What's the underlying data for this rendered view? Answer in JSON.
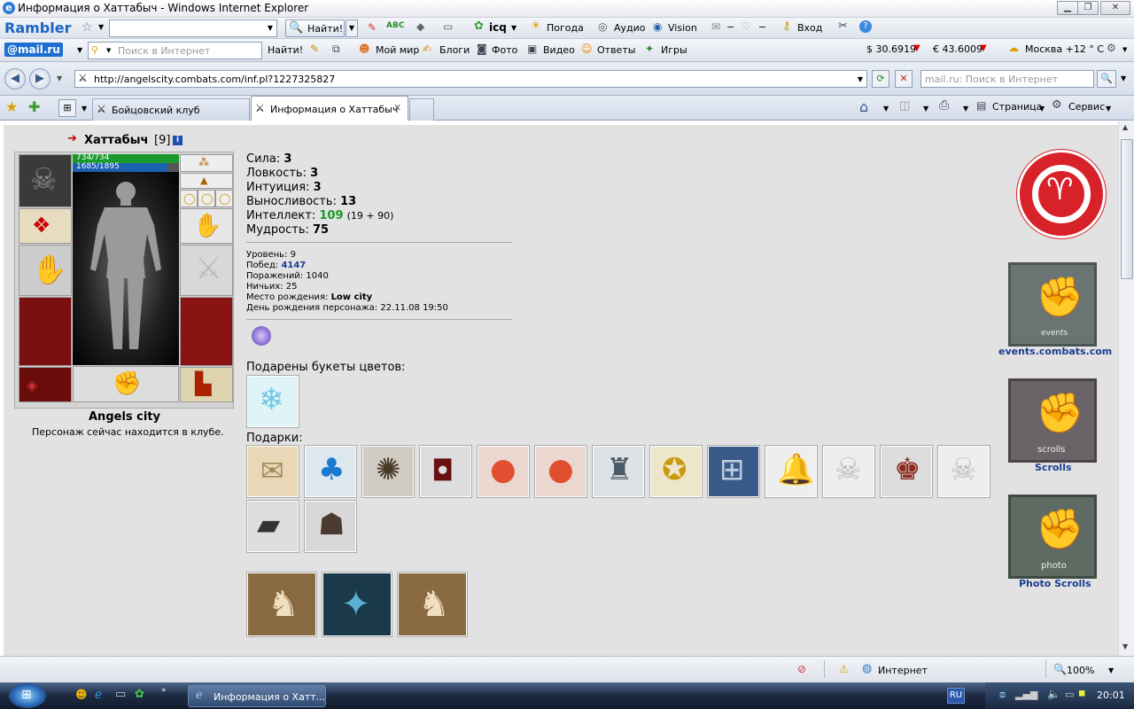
{
  "window": {
    "title": "Информация о Хаттабыч - Windows Internet Explorer"
  },
  "toolbar1": {
    "brand": "Rambler",
    "search_btn": "Найти!",
    "icq": "icq",
    "weather": "Погода",
    "audio": "Аудио",
    "vision": "Vision",
    "login": "Вход",
    "minus1": "−",
    "minus2": "−"
  },
  "toolbar2": {
    "brand": "@mail.ru",
    "search_placeholder": "Поиск в Интернет",
    "search_btn": "Найти!",
    "items": [
      "Мой мир",
      "Блоги",
      "Фото",
      "Видео",
      "Ответы",
      "Игры"
    ],
    "usd": "$ 30.6919",
    "eur": "€ 43.6009",
    "city": "Москва +12 ° C"
  },
  "address": {
    "url": "http://angelscity.combats.com/inf.pl?1227325827",
    "search_placeholder": "mail.ru: Поиск в Интернет"
  },
  "tabs": [
    {
      "label": "Бойцовский клуб"
    },
    {
      "label": "Информация о Хаттабыч"
    }
  ],
  "cmdbar": {
    "page": "Страница",
    "tools": "Сервис"
  },
  "character": {
    "name": "Хаттабыч",
    "level_tag": "[9]",
    "hp": "734/734",
    "mana": "1685/1895",
    "city": "Angels city",
    "status": "Персонаж сейчас находится в клубе.",
    "hp_fraction": 1.0,
    "mana_fraction": 0.89
  },
  "stats": [
    {
      "label": "Сила:",
      "value": "3"
    },
    {
      "label": "Ловкость:",
      "value": "3"
    },
    {
      "label": "Интуиция:",
      "value": "3"
    },
    {
      "label": "Выносливость:",
      "value": "13"
    }
  ],
  "intellect": {
    "label": "Интеллект:",
    "value": "109",
    "extra": "(19 + 90)"
  },
  "wisdom": {
    "label": "Мудрость:",
    "value": "75"
  },
  "info": {
    "level": "Уровень: 9",
    "wins_label": "Побед:",
    "wins": "4147",
    "losses": "Поражений: 1040",
    "draws": "Ничьих: 25",
    "birthplace_label": "Место рождения:",
    "birthplace": "Low city",
    "birthday": "День рождения персонажа: 22.11.08 19:50"
  },
  "flowers_label": "Подарены букеты цветов:",
  "gifts_label": "Подарки:",
  "sidebar": {
    "events_link": "events.combats.com",
    "events_banner": "events",
    "scrolls_link": "Scrolls",
    "scrolls_banner": "scrolls",
    "photo_link": "Photo Scrolls",
    "photo_banner": "photo"
  },
  "status": {
    "zone": "Интернет",
    "zoom": "100%"
  },
  "taskbar": {
    "task": "Информация о Хатт...",
    "lang": "RU",
    "time": "20:01"
  },
  "colors": {
    "accent": "#1a3d8f",
    "hp": "#1a9a2a",
    "mana": "#1b5fb0",
    "logo_red": "#d8222a",
    "intellect": "#1a9a2a"
  }
}
